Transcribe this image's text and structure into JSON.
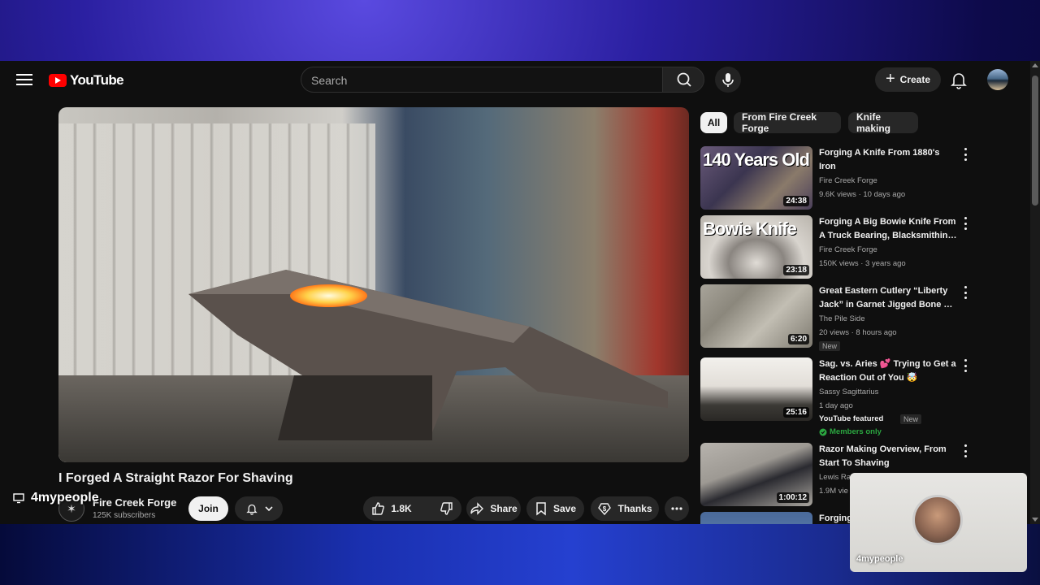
{
  "header": {
    "logo_text": "YouTube",
    "search_placeholder": "Search",
    "create_label": "Create"
  },
  "video": {
    "title": "I Forged A Straight Razor For Shaving",
    "channel_name": "Fire Creek Forge",
    "subscribers": "125K subscribers",
    "join_label": "Join",
    "like_count": "1.8K",
    "share_label": "Share",
    "save_label": "Save",
    "thanks_label": "Thanks"
  },
  "chips": [
    "All",
    "From Fire Creek Forge",
    "Knife making"
  ],
  "recommendations": [
    {
      "thumb_text": "140 Years Old",
      "title": "Forging A Knife From 1880's Iron",
      "channel": "Fire Creek Forge",
      "meta": "9.6K views · 10 days ago",
      "duration": "24:38"
    },
    {
      "thumb_text": "Bowie Knife",
      "title": "Forging A Big Bowie Knife From A Truck Bearing, Blacksmithin…",
      "channel": "Fire Creek Forge",
      "meta": "150K views · 3 years ago",
      "duration": "23:18"
    },
    {
      "thumb_text": "",
      "title": "Great Eastern Cutlery “Liberty Jack” in Garnet Jigged Bone …",
      "channel": "The Pile Side",
      "meta": "20 views · 8 hours ago",
      "duration": "6:20",
      "badge": "New"
    },
    {
      "thumb_text": "",
      "title": "Sag. vs. Aries 💕 Trying to Get a Reaction Out of You 🤯",
      "channel": "Sassy Sagittarius",
      "meta": "1 day ago",
      "featured": "YouTube featured",
      "badge": "New",
      "members": "Members only",
      "duration": "25:16"
    },
    {
      "thumb_text": "",
      "title": "Razor Making Overview, From Start To Shaving",
      "channel": "Lewis Ra",
      "meta": "1.9M vie",
      "duration": "1:00:12"
    },
    {
      "thumb_text": "",
      "title": "Forging",
      "channel": "",
      "meta": "",
      "duration": ""
    }
  ],
  "overlay": {
    "brand": "4mypeople",
    "webcam_name": "4mypeople"
  },
  "colors": {
    "background": "#0f0f0f",
    "chip_bg": "#272727",
    "accent_red": "#ff0000",
    "members_green": "#2ba640"
  }
}
